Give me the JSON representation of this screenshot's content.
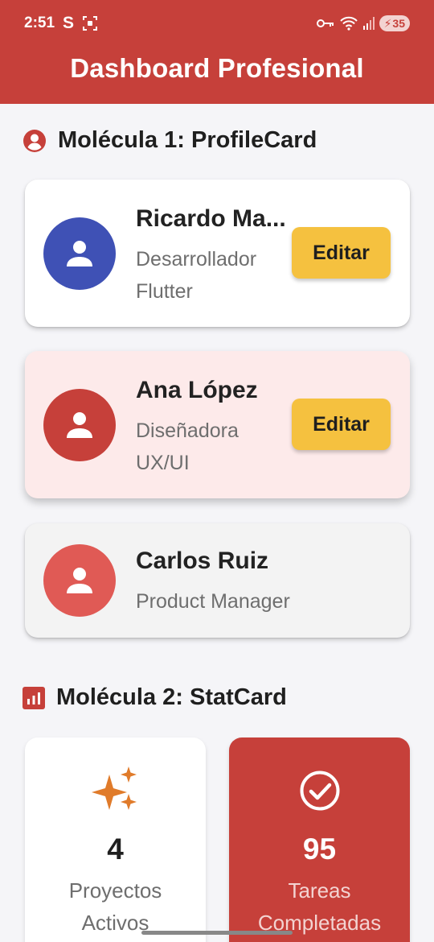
{
  "status_bar": {
    "time": "2:51",
    "battery": "35"
  },
  "header": {
    "title": "Dashboard Profesional"
  },
  "section1": {
    "title": "Molécula 1: ProfileCard"
  },
  "profiles": [
    {
      "name": "Ricardo Ma...",
      "role_line1": "Desarrollador",
      "role_line2": "Flutter",
      "button": "Editar",
      "avatar_color": "#3f51b5",
      "card_color": "#ffffff"
    },
    {
      "name": "Ana López",
      "role_line1": "Diseñadora",
      "role_line2": "UX/UI",
      "button": "Editar",
      "avatar_color": "#c6403a",
      "card_color": "#fdeaea"
    },
    {
      "name": "Carlos Ruiz",
      "role_line1": "Product Manager",
      "avatar_color": "#e05a55",
      "card_color": "#f3f3f3"
    }
  ],
  "section2": {
    "title": "Molécula 2: StatCard"
  },
  "stats": [
    {
      "value": "4",
      "label_line1": "Proyectos",
      "label_line2": "Activos",
      "icon": "sparkles-icon",
      "card_color": "#ffffff",
      "icon_color": "#e07b2a"
    },
    {
      "value": "95",
      "label_line1": "Tareas",
      "label_line2": "Completadas",
      "icon": "check-circle-icon",
      "card_color": "#c6403a",
      "icon_color": "#ffffff"
    }
  ],
  "colors": {
    "primary": "#c6403a",
    "accent": "#f5c13f",
    "background": "#f5f5f8"
  }
}
